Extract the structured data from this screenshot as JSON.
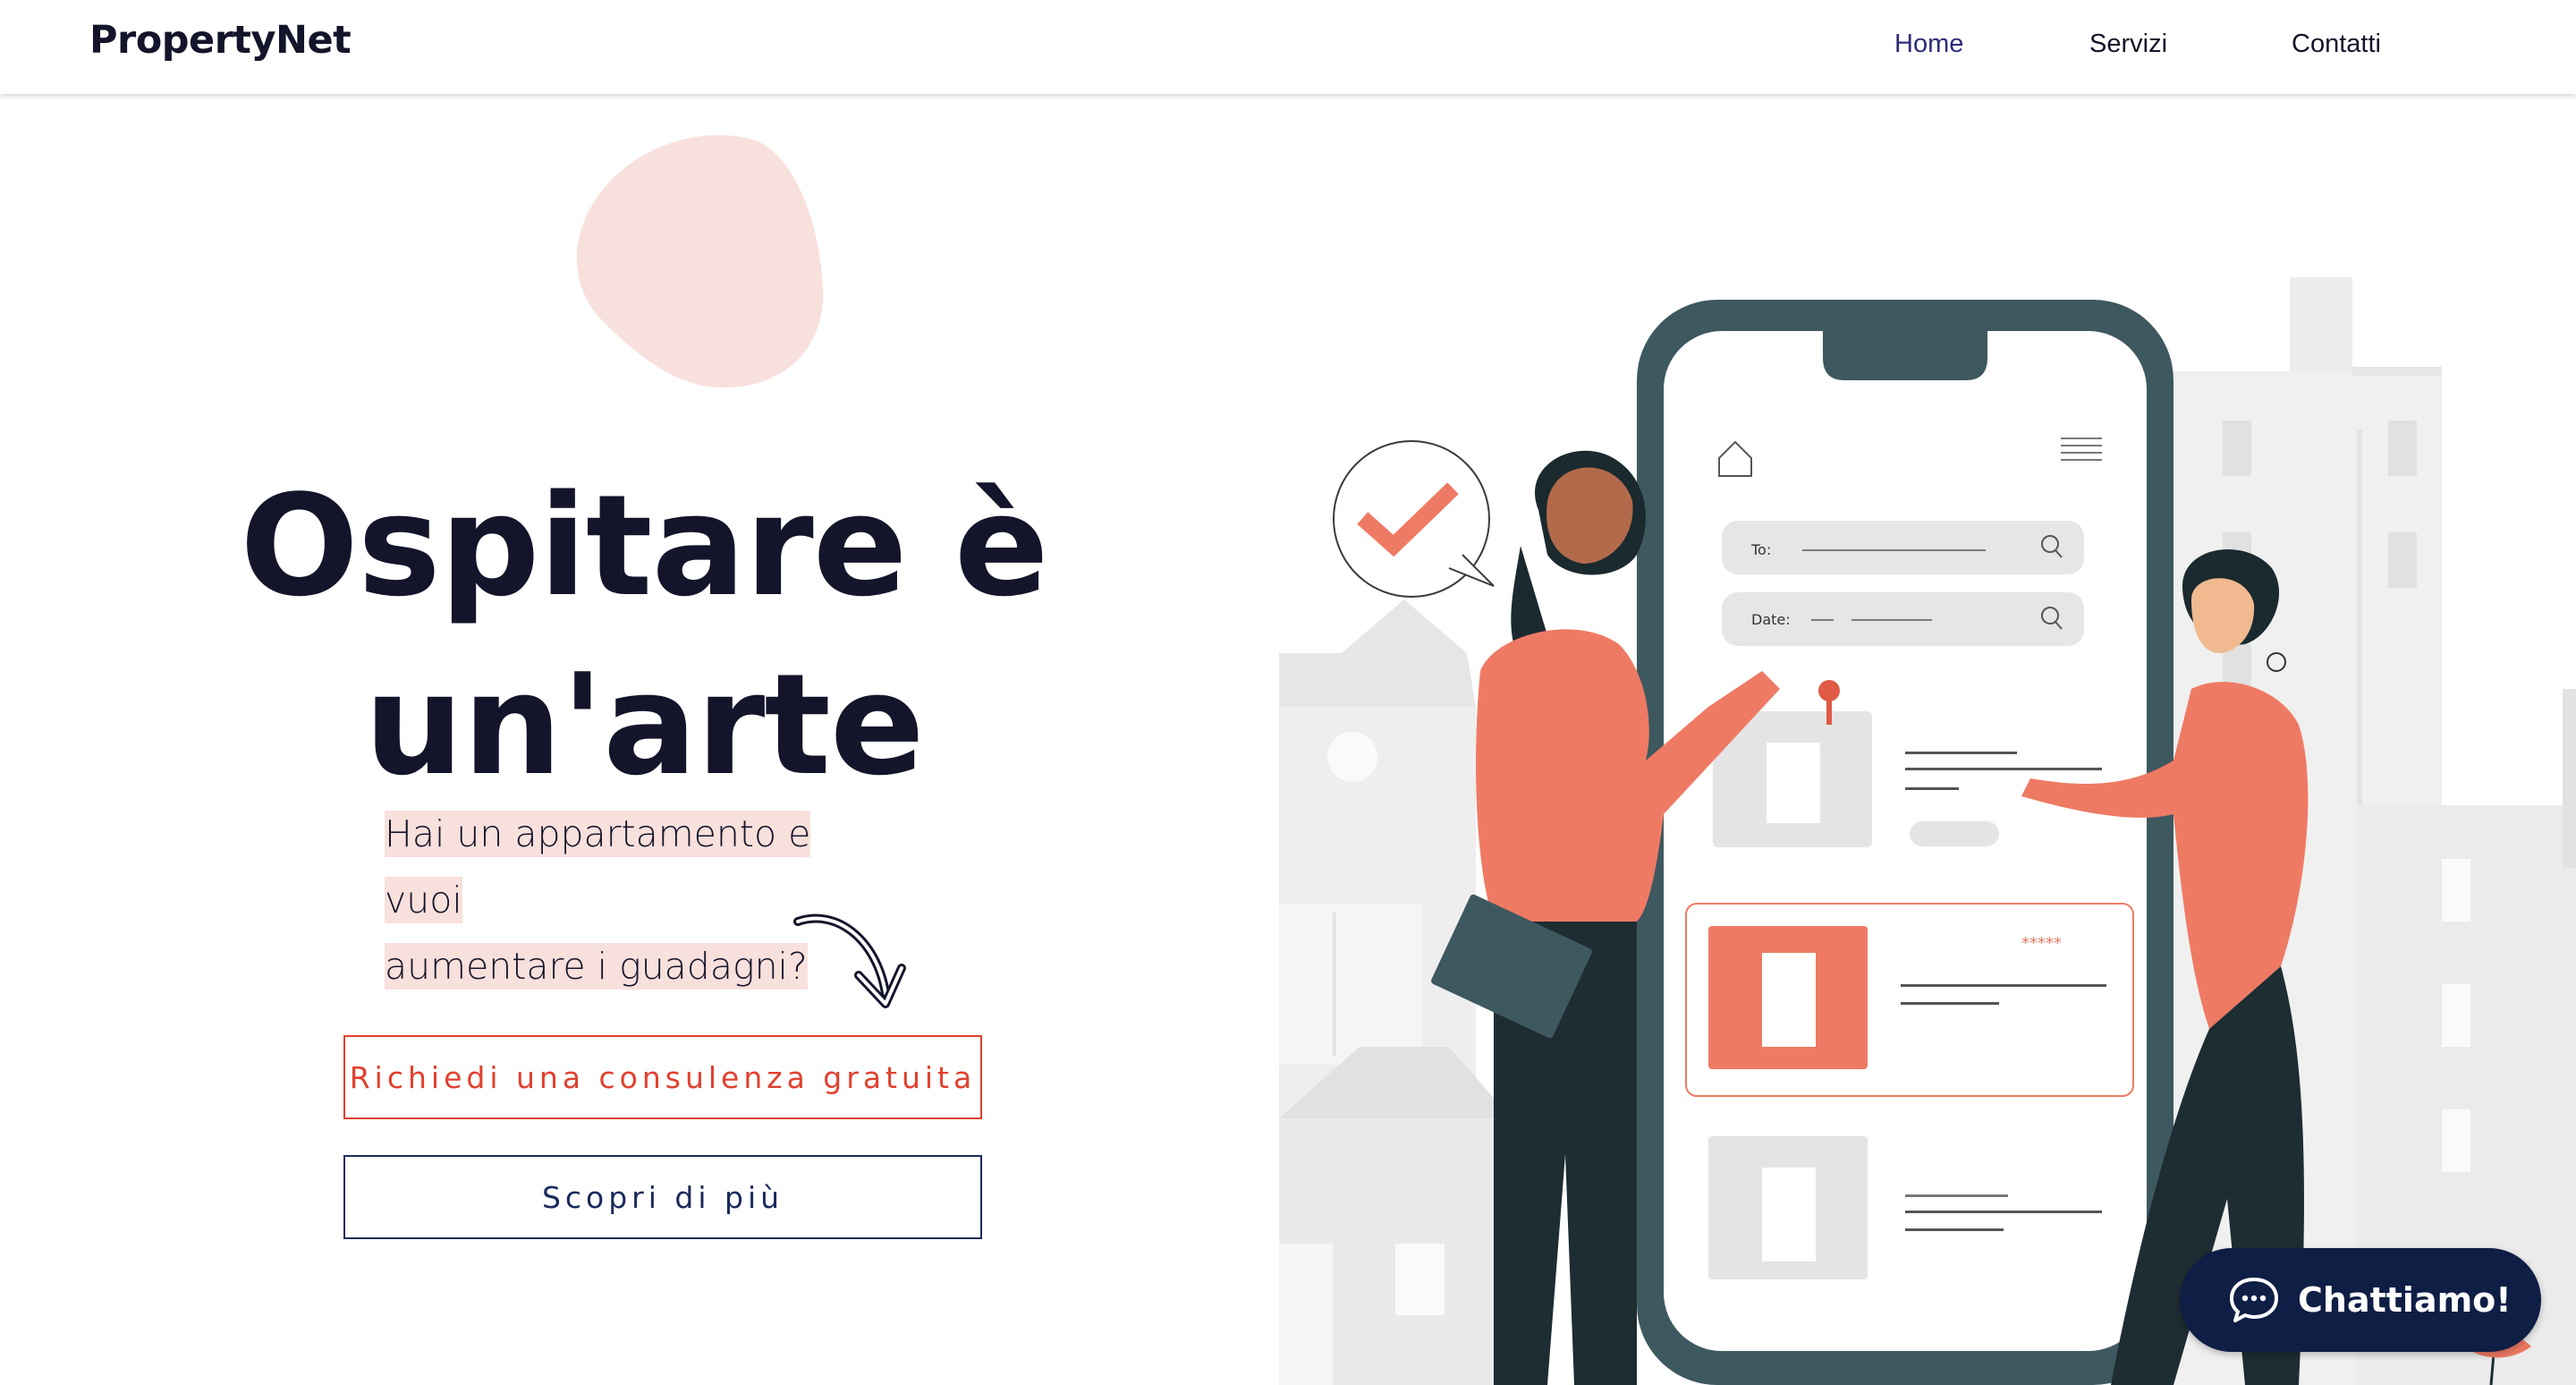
{
  "brand": {
    "name": "PropertyNet"
  },
  "nav": {
    "items": [
      {
        "label": "Home",
        "active": true
      },
      {
        "label": "Servizi",
        "active": false
      },
      {
        "label": "Contatti",
        "active": false
      }
    ]
  },
  "hero": {
    "title_line1": "Ospitare è",
    "title_line2": "un'arte",
    "subtitle_line1": "Hai un appartamento e vuoi",
    "subtitle_line2": "aumentare i guadagni?",
    "primary_cta": "Richiedi una consulenza gratuita",
    "secondary_cta": "Scopri di più"
  },
  "illustration": {
    "search_to_label": "To:",
    "search_date_label": "Date:",
    "rating_text": "*****"
  },
  "chat": {
    "label": "Chattiamo!"
  },
  "colors": {
    "accent": "#e0412f",
    "navy": "#1b2a5c",
    "coral": "#ef7a64",
    "blob_pink": "#f8e0dc",
    "phone_frame": "#3e5860"
  }
}
